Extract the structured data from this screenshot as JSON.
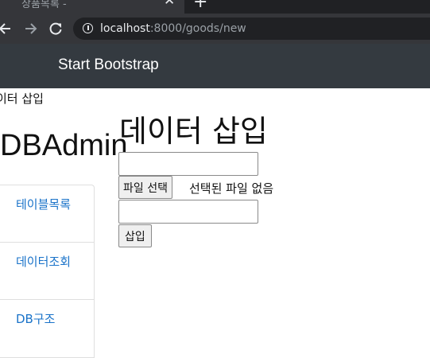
{
  "browser": {
    "tab_title": "상품목록 -",
    "tab_close_glyph": "✕",
    "new_tab_glyph": "+",
    "url_host": "localhost",
    "url_path": ":8000/goods/new",
    "icons": [
      "back-arrow-icon",
      "forward-arrow-icon",
      "reload-icon",
      "info-icon"
    ]
  },
  "navbar": {
    "brand": "Start Bootstrap"
  },
  "page": {
    "small_title": "이터 삽입",
    "sidebar_title": "DBAdmin",
    "sidebar_items": [
      {
        "label": "테이블목록"
      },
      {
        "label": "데이터조회"
      },
      {
        "label": "DB구조"
      }
    ],
    "main_title": "데이터 삽입",
    "form": {
      "text_field_1_value": "",
      "file_button_label": "파일 선택",
      "file_status": "선택된 파일 없음",
      "text_field_2_value": "",
      "submit_label": "삽입"
    }
  },
  "colors": {
    "chrome_dark": "#202124",
    "chrome_toolbar": "#35363a",
    "navbar": "#343a40",
    "link": "#1a73c9"
  }
}
